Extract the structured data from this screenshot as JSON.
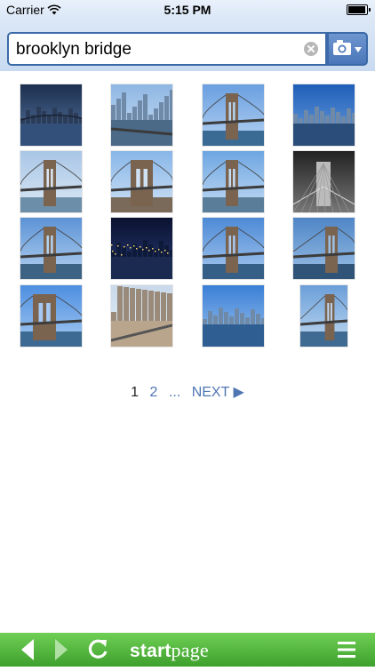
{
  "status_bar": {
    "carrier": "Carrier",
    "time": "5:15 PM"
  },
  "search": {
    "query": "brooklyn bridge"
  },
  "results": {
    "images": [
      {
        "alt": "brooklyn bridge image 1"
      },
      {
        "alt": "brooklyn bridge image 2"
      },
      {
        "alt": "brooklyn bridge image 3"
      },
      {
        "alt": "brooklyn bridge image 4"
      },
      {
        "alt": "brooklyn bridge image 5"
      },
      {
        "alt": "brooklyn bridge image 6"
      },
      {
        "alt": "brooklyn bridge image 7"
      },
      {
        "alt": "brooklyn bridge image 8"
      },
      {
        "alt": "brooklyn bridge image 9"
      },
      {
        "alt": "brooklyn bridge image 10"
      },
      {
        "alt": "brooklyn bridge image 11"
      },
      {
        "alt": "brooklyn bridge image 12"
      },
      {
        "alt": "brooklyn bridge image 13"
      },
      {
        "alt": "brooklyn bridge image 14"
      },
      {
        "alt": "brooklyn bridge image 15"
      },
      {
        "alt": "brooklyn bridge image 16"
      }
    ]
  },
  "pagination": {
    "current": "1",
    "page2": "2",
    "ellipsis": "...",
    "next_label": "NEXT ▶"
  },
  "toolbar": {
    "brand_start": "start",
    "brand_page": "page"
  },
  "colors": {
    "accent_blue": "#3c6aa8",
    "link_blue": "#4f76b3",
    "toolbar_green": "#4cb83a"
  },
  "icons": {
    "back": "back-arrow-icon",
    "forward": "forward-arrow-icon",
    "refresh": "refresh-icon",
    "menu": "hamburger-menu-icon",
    "camera": "camera-icon",
    "clear": "clear-icon",
    "wifi": "wifi-icon",
    "battery": "battery-icon"
  }
}
